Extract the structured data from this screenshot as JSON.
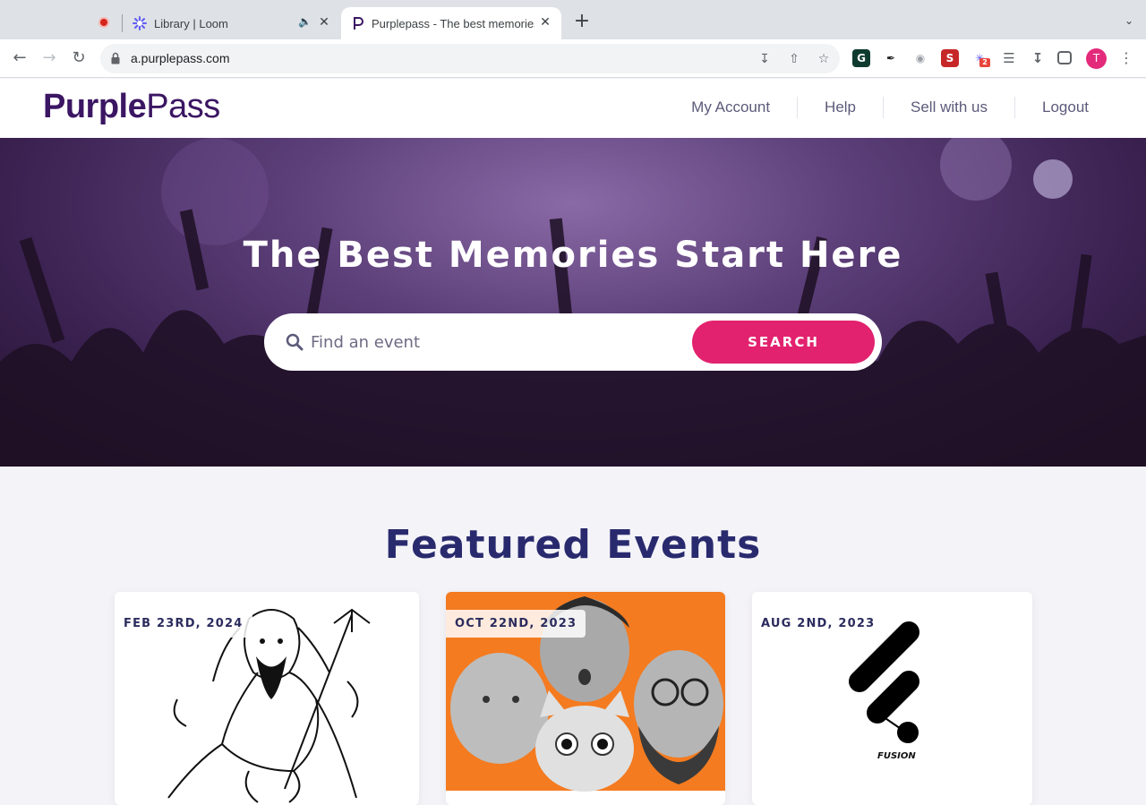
{
  "browser": {
    "tabs": [
      {
        "title": "Library | Loom"
      },
      {
        "title": "Purplepass - The best memories"
      }
    ],
    "url": "a.purplepass.com",
    "profile_initial": "T",
    "extension_badge": "2"
  },
  "site": {
    "logo_part1": "Purple",
    "logo_part2": "Pass",
    "nav": {
      "my_account": "My Account",
      "help": "Help",
      "sell": "Sell with us",
      "logout": "Logout"
    }
  },
  "hero": {
    "title": "The Best Memories Start Here",
    "search_placeholder": "Find an event",
    "search_button": "SEARCH"
  },
  "featured": {
    "title": "Featured Events",
    "events": [
      {
        "date": "FEB 23RD, 2024"
      },
      {
        "date": "OCT 22ND, 2023"
      },
      {
        "date": "AUG 2ND, 2023",
        "logo_text": "FUSION"
      }
    ]
  },
  "colors": {
    "brand_purple": "#3b1663",
    "accent_pink": "#e2226e",
    "heading_navy": "#292a6e"
  }
}
